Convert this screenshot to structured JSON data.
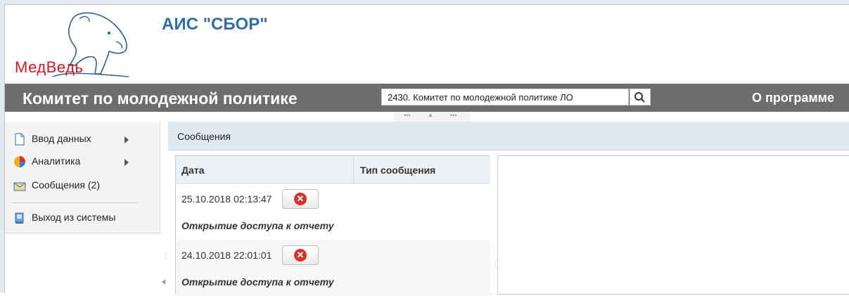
{
  "app": {
    "logo_text": "МедВедь",
    "title": "АИС \"СБОР\""
  },
  "topbar": {
    "org_name": "Комитет по молодежной политике",
    "org_select_value": "2430. Комитет по молодежной политике ЛО",
    "about_link": "О программе"
  },
  "sidebar": {
    "items": [
      {
        "label": "Ввод данных",
        "icon": "document-icon",
        "has_submenu": true
      },
      {
        "label": "Аналитика",
        "icon": "pie-chart-icon",
        "has_submenu": true
      },
      {
        "label": "Сообщения (2)",
        "icon": "envelope-icon",
        "has_submenu": false
      },
      {
        "label": "Выход из системы",
        "icon": "computer-icon",
        "has_submenu": false
      }
    ]
  },
  "content": {
    "header": "Сообщения",
    "table": {
      "columns": [
        "Дата",
        "Тип сообщения"
      ],
      "rows": [
        {
          "date": "25.10.2018 02:13:47",
          "message": "Открытие доступа к отчету"
        },
        {
          "date": "24.10.2018 22:01:01",
          "message": "Открытие доступа к отчету"
        }
      ]
    }
  },
  "colors": {
    "brand_red": "#cc1a23",
    "title_blue": "#336f9e",
    "bar_gray": "#6d6d6d",
    "header_blue": "#dfe9f2",
    "delete_red": "#d8322b"
  }
}
